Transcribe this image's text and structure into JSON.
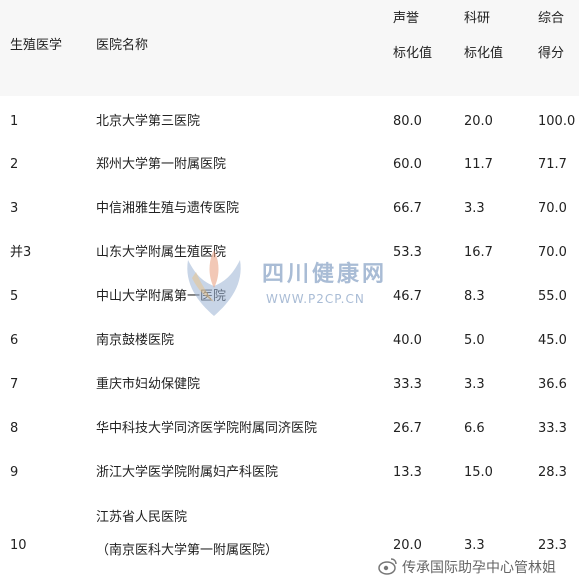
{
  "header": {
    "col_rank": "生殖医学",
    "col_name": "医院名称",
    "col_rep_top": "声誉",
    "col_rep_bottom": "标化值",
    "col_sci_top": "科研",
    "col_sci_bottom": "标化值",
    "col_tot_top": "综合",
    "col_tot_bottom": "得分"
  },
  "rows": [
    {
      "rank": "1",
      "name": "北京大学第三医院",
      "rep": "80.0",
      "sci": "20.0",
      "tot": "100.0"
    },
    {
      "rank": "2",
      "name": "郑州大学第一附属医院",
      "rep": "60.0",
      "sci": "11.7",
      "tot": "71.7"
    },
    {
      "rank": "3",
      "name": "中信湘雅生殖与遗传医院",
      "rep": "66.7",
      "sci": "3.3",
      "tot": "70.0"
    },
    {
      "rank": "并3",
      "name": "山东大学附属生殖医院",
      "rep": "53.3",
      "sci": "16.7",
      "tot": "70.0"
    },
    {
      "rank": "5",
      "name": "中山大学附属第一医院",
      "rep": "46.7",
      "sci": "8.3",
      "tot": "55.0"
    },
    {
      "rank": "6",
      "name": "南京鼓楼医院",
      "rep": "40.0",
      "sci": "5.0",
      "tot": "45.0"
    },
    {
      "rank": "7",
      "name": "重庆市妇幼保健院",
      "rep": "33.3",
      "sci": "3.3",
      "tot": "36.6"
    },
    {
      "rank": "8",
      "name": "华中科技大学同济医学院附属同济医院",
      "rep": "26.7",
      "sci": "6.6",
      "tot": "33.3"
    },
    {
      "rank": "9",
      "name": "浙江大学医学院附属妇产科医院",
      "rep": "13.3",
      "sci": "15.0",
      "tot": "28.3"
    }
  ],
  "last_row": {
    "rank": "10",
    "name_line1": "江苏省人民医院",
    "name_line2": "（南京医科大学第一附属医院）",
    "rep": "20.0",
    "sci": "3.3",
    "tot": "23.3"
  },
  "watermark": {
    "title": "四川健康网",
    "url": "WWW.P2CP.CN"
  },
  "weibo_watermark": "传承国际助孕中心管林姐",
  "colors": {
    "text": "#222222",
    "header_bg": "#f7f7f7",
    "row_bg": "#ffffff",
    "watermark": "#8da6c8"
  }
}
